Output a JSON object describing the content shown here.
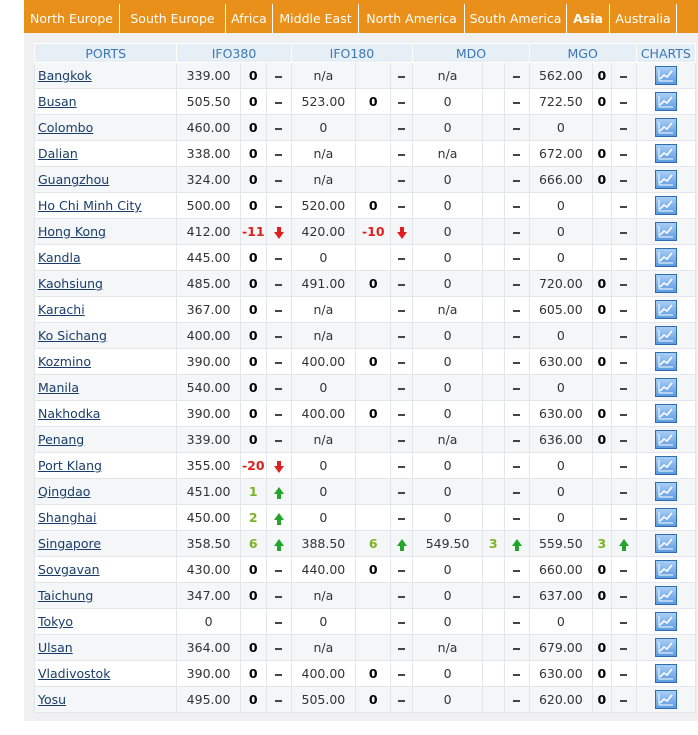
{
  "tabs": [
    {
      "label": "North Europe",
      "active": false
    },
    {
      "label": "South Europe",
      "active": false
    },
    {
      "label": "Africa",
      "active": false
    },
    {
      "label": "Middle East",
      "active": false
    },
    {
      "label": "North America",
      "active": false
    },
    {
      "label": "South America",
      "active": false
    },
    {
      "label": "Asia",
      "active": true
    },
    {
      "label": "Australia",
      "active": false
    }
  ],
  "headers": {
    "ports": "PORTS",
    "ifo380": "IFO380",
    "ifo180": "IFO180",
    "mdo": "MDO",
    "mgo": "MGO",
    "charts": "CHARTS"
  },
  "colors": {
    "accent": "#e8901a",
    "header_text": "#3b78b5",
    "link": "#1a3d6b",
    "negative": "#e02020",
    "positive": "#7cb32a"
  },
  "indicator_icons": {
    "up": "green-up-arrow-icon",
    "down": "red-down-arrow-icon",
    "none": "dash-icon"
  },
  "chart_icon": "line-chart-icon",
  "rows": [
    {
      "port": "Bangkok",
      "ifo380": {
        "price": "339.00",
        "chg": "0",
        "dir": "none"
      },
      "ifo180": {
        "price": "n/a",
        "chg": "",
        "dir": "none"
      },
      "mdo": {
        "price": "n/a",
        "chg": "",
        "dir": "none"
      },
      "mgo": {
        "price": "562.00",
        "chg": "0",
        "dir": "none"
      }
    },
    {
      "port": "Busan",
      "ifo380": {
        "price": "505.50",
        "chg": "0",
        "dir": "none"
      },
      "ifo180": {
        "price": "523.00",
        "chg": "0",
        "dir": "none"
      },
      "mdo": {
        "price": "0",
        "chg": "",
        "dir": "none"
      },
      "mgo": {
        "price": "722.50",
        "chg": "0",
        "dir": "none"
      }
    },
    {
      "port": "Colombo",
      "ifo380": {
        "price": "460.00",
        "chg": "0",
        "dir": "none"
      },
      "ifo180": {
        "price": "0",
        "chg": "",
        "dir": "none"
      },
      "mdo": {
        "price": "0",
        "chg": "",
        "dir": "none"
      },
      "mgo": {
        "price": "0",
        "chg": "",
        "dir": "none"
      }
    },
    {
      "port": "Dalian",
      "ifo380": {
        "price": "338.00",
        "chg": "0",
        "dir": "none"
      },
      "ifo180": {
        "price": "n/a",
        "chg": "",
        "dir": "none"
      },
      "mdo": {
        "price": "n/a",
        "chg": "",
        "dir": "none"
      },
      "mgo": {
        "price": "672.00",
        "chg": "0",
        "dir": "none"
      }
    },
    {
      "port": "Guangzhou",
      "ifo380": {
        "price": "324.00",
        "chg": "0",
        "dir": "none"
      },
      "ifo180": {
        "price": "n/a",
        "chg": "",
        "dir": "none"
      },
      "mdo": {
        "price": "0",
        "chg": "",
        "dir": "none"
      },
      "mgo": {
        "price": "666.00",
        "chg": "0",
        "dir": "none"
      }
    },
    {
      "port": "Ho Chi Minh City",
      "ifo380": {
        "price": "500.00",
        "chg": "0",
        "dir": "none"
      },
      "ifo180": {
        "price": "520.00",
        "chg": "0",
        "dir": "none"
      },
      "mdo": {
        "price": "0",
        "chg": "",
        "dir": "none"
      },
      "mgo": {
        "price": "0",
        "chg": "",
        "dir": "none"
      }
    },
    {
      "port": "Hong Kong",
      "ifo380": {
        "price": "412.00",
        "chg": "-11",
        "dir": "down"
      },
      "ifo180": {
        "price": "420.00",
        "chg": "-10",
        "dir": "down"
      },
      "mdo": {
        "price": "0",
        "chg": "",
        "dir": "none"
      },
      "mgo": {
        "price": "0",
        "chg": "",
        "dir": "none"
      }
    },
    {
      "port": "Kandla",
      "ifo380": {
        "price": "445.00",
        "chg": "0",
        "dir": "none"
      },
      "ifo180": {
        "price": "0",
        "chg": "",
        "dir": "none"
      },
      "mdo": {
        "price": "0",
        "chg": "",
        "dir": "none"
      },
      "mgo": {
        "price": "0",
        "chg": "",
        "dir": "none"
      }
    },
    {
      "port": "Kaohsiung",
      "ifo380": {
        "price": "485.00",
        "chg": "0",
        "dir": "none"
      },
      "ifo180": {
        "price": "491.00",
        "chg": "0",
        "dir": "none"
      },
      "mdo": {
        "price": "0",
        "chg": "",
        "dir": "none"
      },
      "mgo": {
        "price": "720.00",
        "chg": "0",
        "dir": "none"
      }
    },
    {
      "port": "Karachi",
      "ifo380": {
        "price": "367.00",
        "chg": "0",
        "dir": "none"
      },
      "ifo180": {
        "price": "n/a",
        "chg": "",
        "dir": "none"
      },
      "mdo": {
        "price": "n/a",
        "chg": "",
        "dir": "none"
      },
      "mgo": {
        "price": "605.00",
        "chg": "0",
        "dir": "none"
      }
    },
    {
      "port": "Ko Sichang",
      "ifo380": {
        "price": "400.00",
        "chg": "0",
        "dir": "none"
      },
      "ifo180": {
        "price": "n/a",
        "chg": "",
        "dir": "none"
      },
      "mdo": {
        "price": "0",
        "chg": "",
        "dir": "none"
      },
      "mgo": {
        "price": "0",
        "chg": "",
        "dir": "none"
      }
    },
    {
      "port": "Kozmino",
      "ifo380": {
        "price": "390.00",
        "chg": "0",
        "dir": "none"
      },
      "ifo180": {
        "price": "400.00",
        "chg": "0",
        "dir": "none"
      },
      "mdo": {
        "price": "0",
        "chg": "",
        "dir": "none"
      },
      "mgo": {
        "price": "630.00",
        "chg": "0",
        "dir": "none"
      }
    },
    {
      "port": "Manila",
      "ifo380": {
        "price": "540.00",
        "chg": "0",
        "dir": "none"
      },
      "ifo180": {
        "price": "0",
        "chg": "",
        "dir": "none"
      },
      "mdo": {
        "price": "0",
        "chg": "",
        "dir": "none"
      },
      "mgo": {
        "price": "0",
        "chg": "",
        "dir": "none"
      }
    },
    {
      "port": "Nakhodka",
      "ifo380": {
        "price": "390.00",
        "chg": "0",
        "dir": "none"
      },
      "ifo180": {
        "price": "400.00",
        "chg": "0",
        "dir": "none"
      },
      "mdo": {
        "price": "0",
        "chg": "",
        "dir": "none"
      },
      "mgo": {
        "price": "630.00",
        "chg": "0",
        "dir": "none"
      }
    },
    {
      "port": "Penang",
      "ifo380": {
        "price": "339.00",
        "chg": "0",
        "dir": "none"
      },
      "ifo180": {
        "price": "n/a",
        "chg": "",
        "dir": "none"
      },
      "mdo": {
        "price": "n/a",
        "chg": "",
        "dir": "none"
      },
      "mgo": {
        "price": "636.00",
        "chg": "0",
        "dir": "none"
      }
    },
    {
      "port": "Port Klang",
      "ifo380": {
        "price": "355.00",
        "chg": "-20",
        "dir": "down"
      },
      "ifo180": {
        "price": "0",
        "chg": "",
        "dir": "none"
      },
      "mdo": {
        "price": "0",
        "chg": "",
        "dir": "none"
      },
      "mgo": {
        "price": "0",
        "chg": "",
        "dir": "none"
      }
    },
    {
      "port": "Qingdao",
      "ifo380": {
        "price": "451.00",
        "chg": "1",
        "dir": "up"
      },
      "ifo180": {
        "price": "0",
        "chg": "",
        "dir": "none"
      },
      "mdo": {
        "price": "0",
        "chg": "",
        "dir": "none"
      },
      "mgo": {
        "price": "0",
        "chg": "",
        "dir": "none"
      }
    },
    {
      "port": "Shanghai",
      "ifo380": {
        "price": "450.00",
        "chg": "2",
        "dir": "up"
      },
      "ifo180": {
        "price": "0",
        "chg": "",
        "dir": "none"
      },
      "mdo": {
        "price": "0",
        "chg": "",
        "dir": "none"
      },
      "mgo": {
        "price": "0",
        "chg": "",
        "dir": "none"
      }
    },
    {
      "port": "Singapore",
      "ifo380": {
        "price": "358.50",
        "chg": "6",
        "dir": "up"
      },
      "ifo180": {
        "price": "388.50",
        "chg": "6",
        "dir": "up"
      },
      "mdo": {
        "price": "549.50",
        "chg": "3",
        "dir": "up"
      },
      "mgo": {
        "price": "559.50",
        "chg": "3",
        "dir": "up"
      }
    },
    {
      "port": "Sovgavan",
      "ifo380": {
        "price": "430.00",
        "chg": "0",
        "dir": "none"
      },
      "ifo180": {
        "price": "440.00",
        "chg": "0",
        "dir": "none"
      },
      "mdo": {
        "price": "0",
        "chg": "",
        "dir": "none"
      },
      "mgo": {
        "price": "660.00",
        "chg": "0",
        "dir": "none"
      }
    },
    {
      "port": "Taichung",
      "ifo380": {
        "price": "347.00",
        "chg": "0",
        "dir": "none"
      },
      "ifo180": {
        "price": "n/a",
        "chg": "",
        "dir": "none"
      },
      "mdo": {
        "price": "0",
        "chg": "",
        "dir": "none"
      },
      "mgo": {
        "price": "637.00",
        "chg": "0",
        "dir": "none"
      }
    },
    {
      "port": "Tokyo",
      "ifo380": {
        "price": "0",
        "chg": "",
        "dir": "none"
      },
      "ifo180": {
        "price": "0",
        "chg": "",
        "dir": "none"
      },
      "mdo": {
        "price": "0",
        "chg": "",
        "dir": "none"
      },
      "mgo": {
        "price": "0",
        "chg": "",
        "dir": "none"
      }
    },
    {
      "port": "Ulsan",
      "ifo380": {
        "price": "364.00",
        "chg": "0",
        "dir": "none"
      },
      "ifo180": {
        "price": "n/a",
        "chg": "",
        "dir": "none"
      },
      "mdo": {
        "price": "n/a",
        "chg": "",
        "dir": "none"
      },
      "mgo": {
        "price": "679.00",
        "chg": "0",
        "dir": "none"
      }
    },
    {
      "port": "Vladivostok",
      "ifo380": {
        "price": "390.00",
        "chg": "0",
        "dir": "none"
      },
      "ifo180": {
        "price": "400.00",
        "chg": "0",
        "dir": "none"
      },
      "mdo": {
        "price": "0",
        "chg": "",
        "dir": "none"
      },
      "mgo": {
        "price": "630.00",
        "chg": "0",
        "dir": "none"
      }
    },
    {
      "port": "Yosu",
      "ifo380": {
        "price": "495.00",
        "chg": "0",
        "dir": "none"
      },
      "ifo180": {
        "price": "505.00",
        "chg": "0",
        "dir": "none"
      },
      "mdo": {
        "price": "0",
        "chg": "",
        "dir": "none"
      },
      "mgo": {
        "price": "620.00",
        "chg": "0",
        "dir": "none"
      }
    }
  ]
}
